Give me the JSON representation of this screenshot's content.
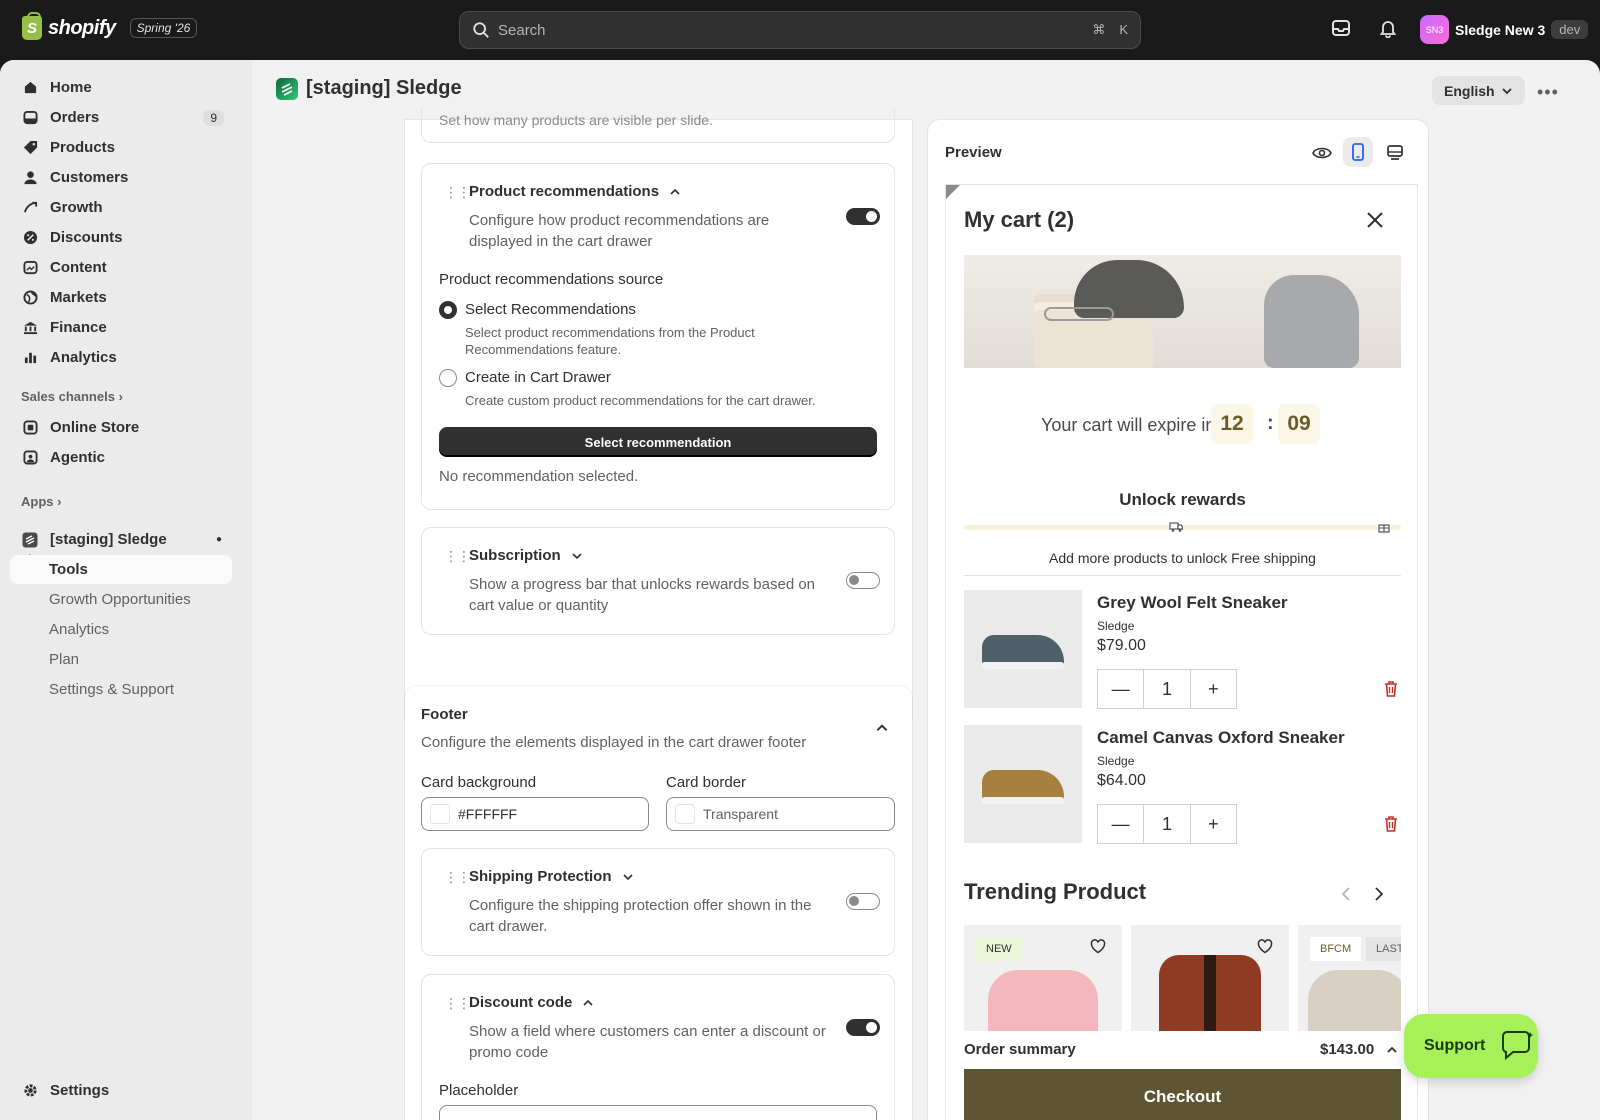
{
  "topbar": {
    "logo_text": "shopify",
    "release_tag": "Spring '26",
    "search_placeholder": "Search",
    "search_kbd_1": "⌘",
    "search_kbd_2": "K",
    "user_initials": "SN3",
    "user_name": "Sledge New 3",
    "env_tag": "dev"
  },
  "sidebar": {
    "items": [
      {
        "label": "Home"
      },
      {
        "label": "Orders",
        "badge": "9"
      },
      {
        "label": "Products"
      },
      {
        "label": "Customers"
      },
      {
        "label": "Growth"
      },
      {
        "label": "Discounts"
      },
      {
        "label": "Content"
      },
      {
        "label": "Markets"
      },
      {
        "label": "Finance"
      },
      {
        "label": "Analytics"
      }
    ],
    "sales_channels_label": "Sales channels",
    "channels": [
      {
        "label": "Online Store"
      },
      {
        "label": "Agentic"
      }
    ],
    "apps_label": "Apps",
    "app_name": "[staging] Sledge",
    "app_sub": [
      {
        "label": "Tools"
      },
      {
        "label": "Growth Opportunities"
      },
      {
        "label": "Analytics"
      },
      {
        "label": "Plan"
      },
      {
        "label": "Settings & Support"
      }
    ],
    "settings_label": "Settings"
  },
  "page": {
    "title": "[staging] Sledge",
    "language": "English"
  },
  "settings": {
    "truncated_text": "Set how many products are visible per slide.",
    "product_recs": {
      "title": "Product recommendations",
      "description": "Configure how product recommendations are displayed in the cart drawer",
      "source_label": "Product recommendations source",
      "option1_label": "Select Recommendations",
      "option1_desc": "Select product recommendations from the Product Recommendations feature.",
      "option2_label": "Create in Cart Drawer",
      "option2_desc": "Create custom product recommendations for the cart drawer.",
      "button": "Select recommendation",
      "status": "No recommendation selected."
    },
    "subscription": {
      "title": "Subscription",
      "description": "Show a progress bar that unlocks rewards based on cart value or quantity"
    },
    "footer": {
      "title": "Footer",
      "description": "Configure the elements displayed in the cart drawer footer",
      "card_bg_label": "Card background",
      "card_bg_value": "#FFFFFF",
      "card_border_label": "Card border",
      "card_border_value": "Transparent"
    },
    "shipping": {
      "title": "Shipping Protection",
      "description": "Configure the shipping protection offer shown in the cart drawer."
    },
    "discount": {
      "title": "Discount code",
      "description": "Show a field where customers can enter a discount or promo code",
      "placeholder_label": "Placeholder"
    }
  },
  "preview": {
    "title": "Preview",
    "cart_title": "My cart (2)",
    "expire_text": "Your cart will expire in",
    "timer_min": "12",
    "timer_sep": ":",
    "timer_sec": "09",
    "rewards_title": "Unlock rewards",
    "rewards_progress": 0,
    "rewards_text": "Add more products to unlock Free shipping",
    "items": [
      {
        "name": "Grey Wool Felt Sneaker",
        "vendor": "Sledge",
        "price": "$79.00",
        "qty": "1"
      },
      {
        "name": "Camel Canvas Oxford Sneaker",
        "vendor": "Sledge",
        "price": "$64.00",
        "qty": "1"
      }
    ],
    "trending_title": "Trending Product",
    "trending_badges": [
      "NEW",
      "BFCM",
      "LAST"
    ],
    "order_summary_label": "Order summary",
    "order_total": "$143.00",
    "checkout_label": "Checkout"
  },
  "support_label": "Support",
  "colors": {
    "accent_dark": "#303030",
    "support_green": "#a6f05a",
    "checkout_brown": "#5e5535",
    "delete_red": "#c9302c"
  }
}
